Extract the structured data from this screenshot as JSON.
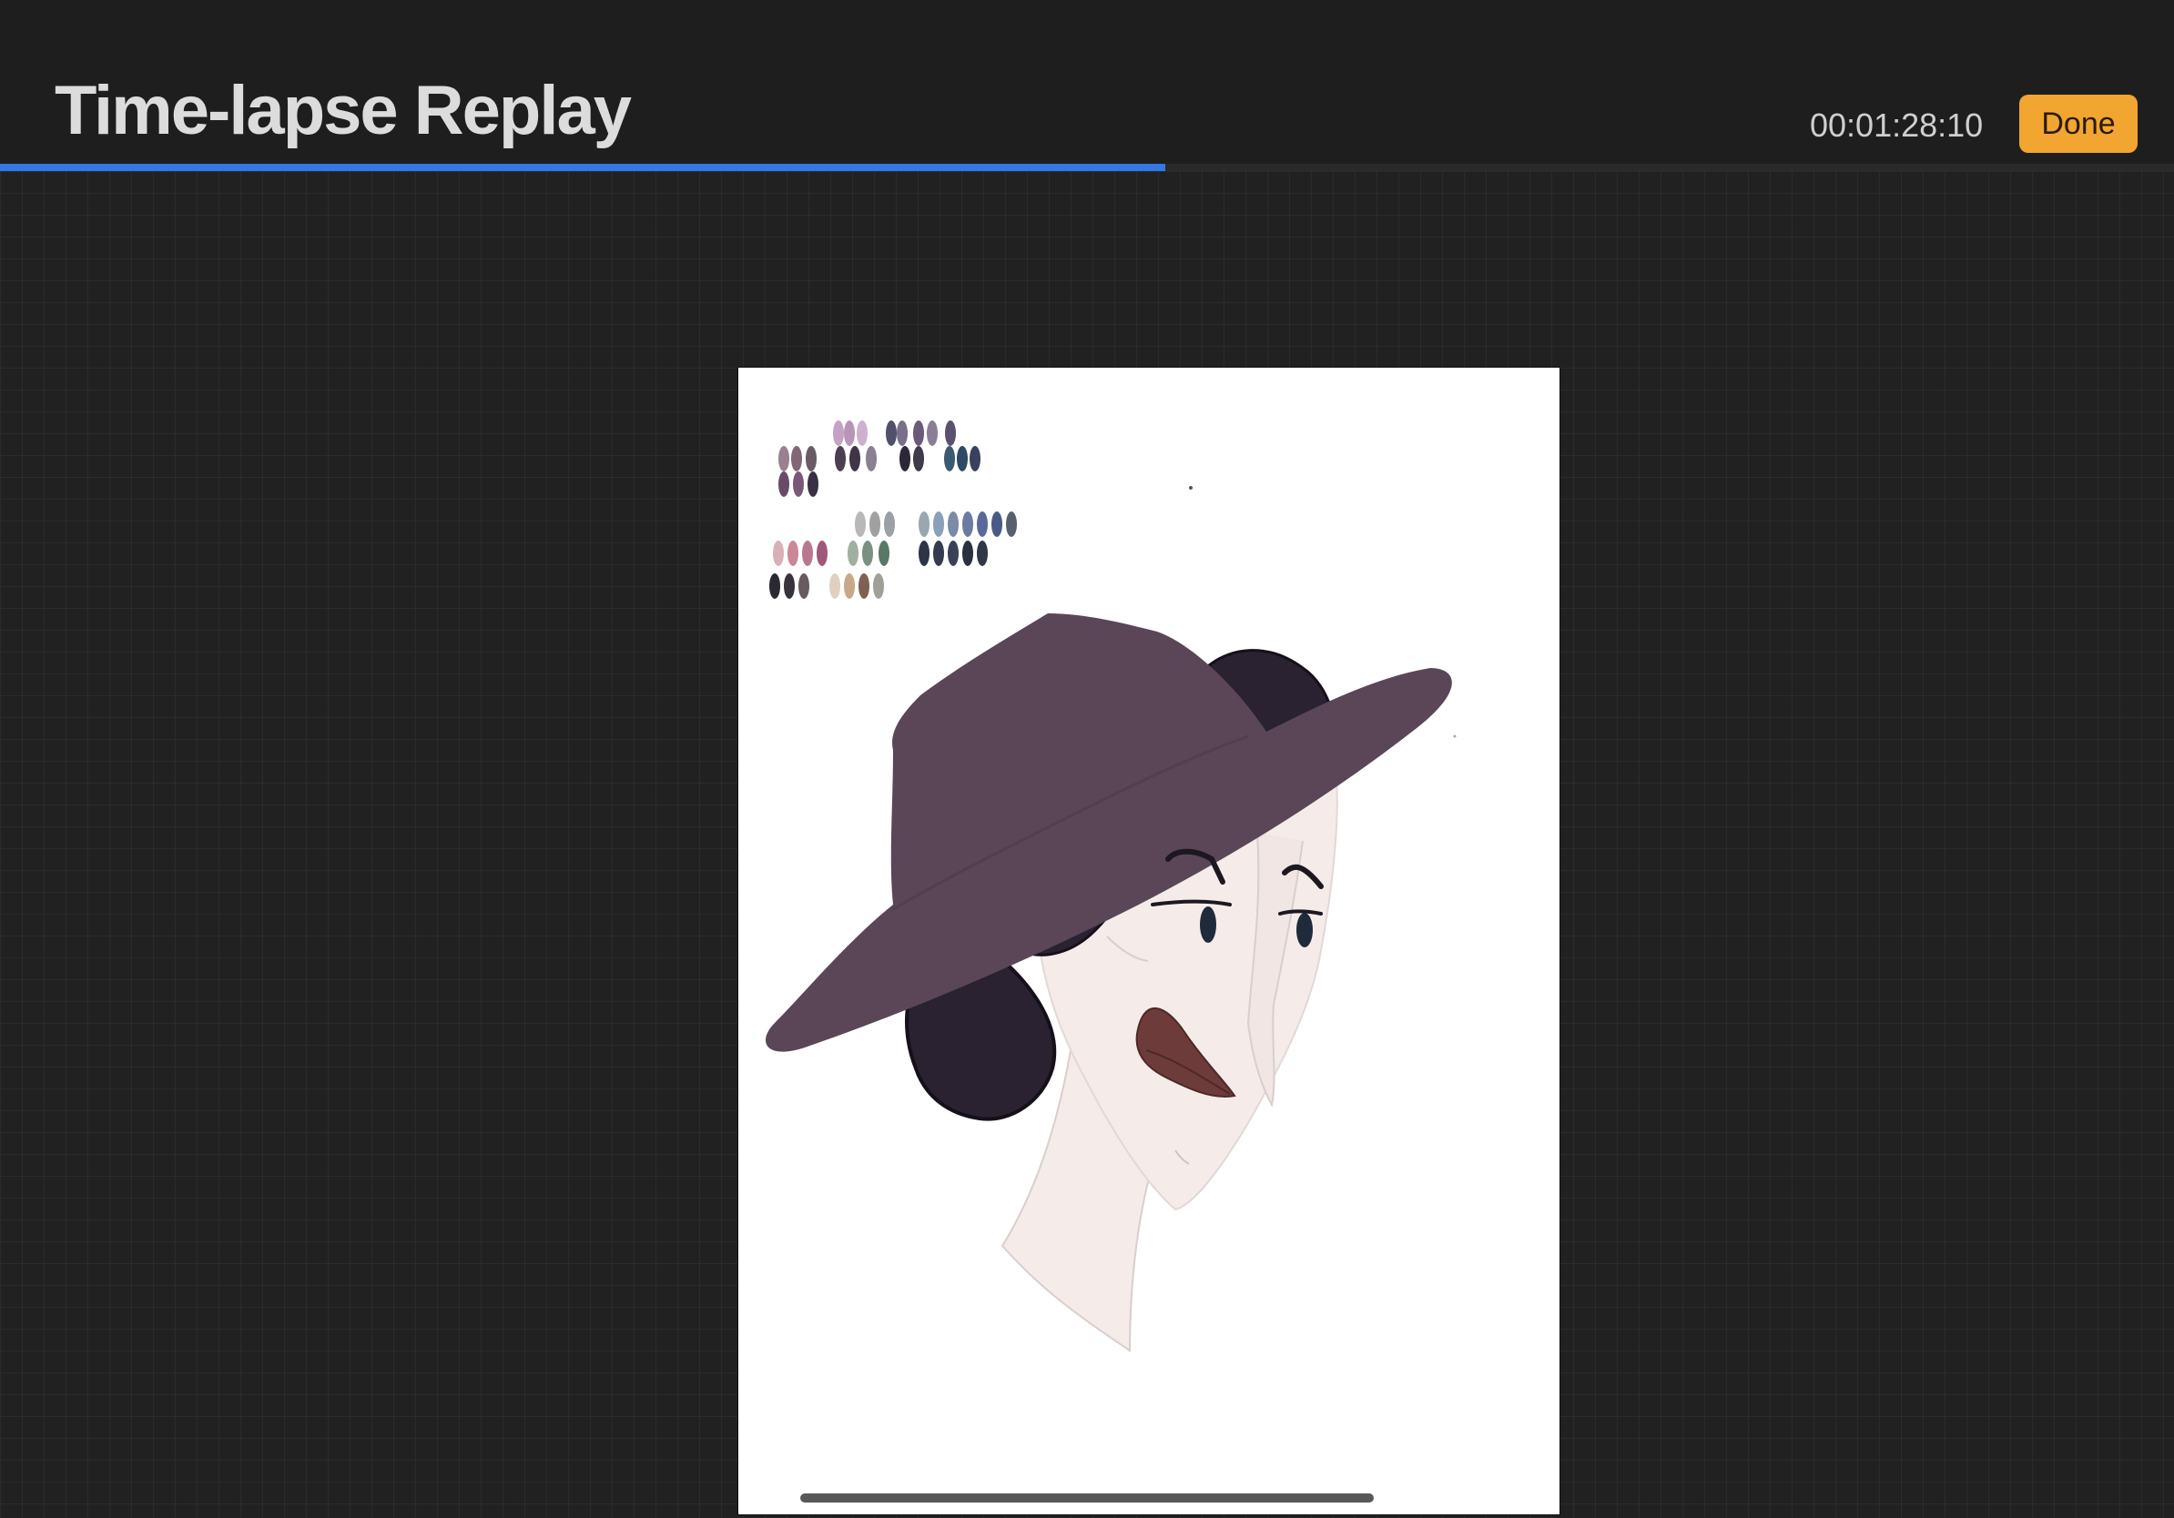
{
  "header": {
    "title": "Time-lapse Replay",
    "timecode": "00:01:28:10",
    "done_label": "Done"
  },
  "playback": {
    "progress_fraction": 0.536
  },
  "colors": {
    "accent_progress": "#3278e6",
    "done_button": "#f2a531",
    "hat": "#5a4656",
    "hair": "#2a2230",
    "skin": "#f5ecea",
    "lips": "#6d3b3a"
  },
  "icons": []
}
